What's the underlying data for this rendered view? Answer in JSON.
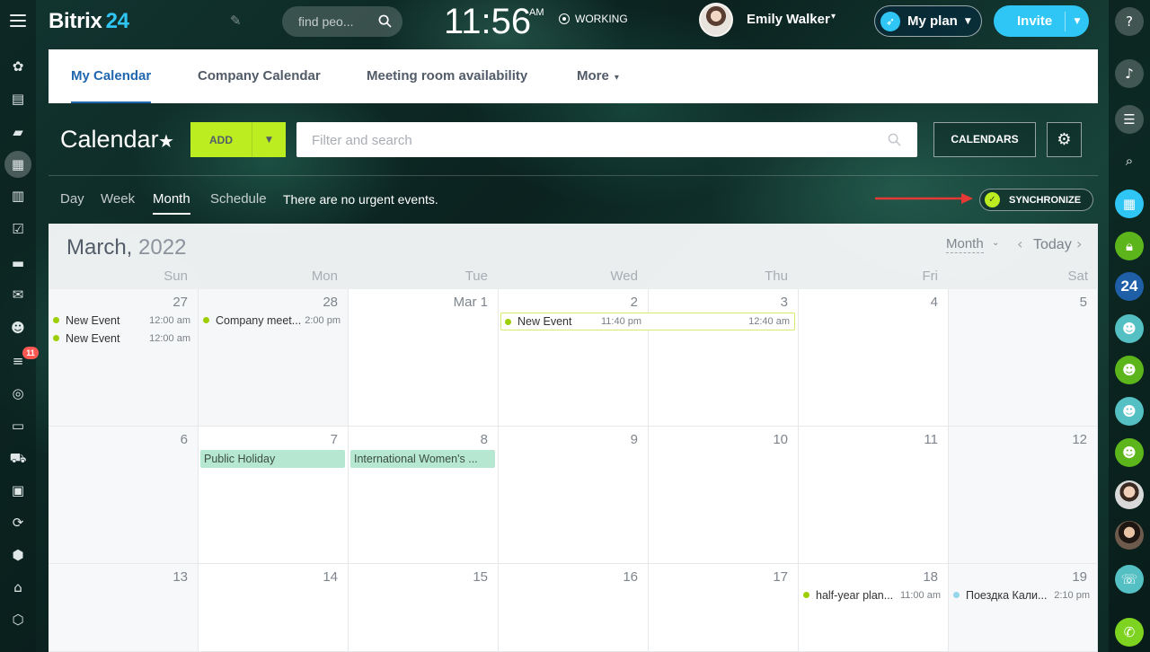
{
  "app": {
    "logo_text": "Bitrix",
    "logo_num": "24"
  },
  "header": {
    "search_placeholder": "find peo...",
    "clock": "11:56",
    "ampm": "AM",
    "work_status": "WORKING",
    "user_name": "Emily Walker",
    "myplan_label": "My plan",
    "invite_label": "Invite"
  },
  "left_sidebar": {
    "icons": [
      "menu-icon",
      "feed-icon",
      "tasks-icon",
      "chat-icon",
      "calendar-icon",
      "docs-icon",
      "checklist-icon",
      "drive-icon",
      "mail-icon",
      "groups-icon",
      "crm-icon",
      "sites-icon",
      "projects-icon",
      "shop-icon",
      "contacts-icon",
      "automation-icon",
      "inventory-icon",
      "marketplace-icon",
      "box-icon"
    ],
    "crm_badge": "11"
  },
  "right_sidebar": {
    "icons": [
      "help-icon",
      "bell-icon",
      "chat-bubble-icon",
      "search-icon",
      "calendar-icon",
      "lock-icon",
      "bitrix24-icon",
      "group-icon",
      "group-icon",
      "group-icon",
      "group-icon",
      "avatar",
      "avatar",
      "phone-icon",
      "call-icon"
    ],
    "bitrix_label": "24"
  },
  "tabs": [
    {
      "label": "My Calendar",
      "active": true
    },
    {
      "label": "Company Calendar",
      "active": false
    },
    {
      "label": "Meeting room availability",
      "active": false
    },
    {
      "label": "More",
      "active": false
    }
  ],
  "toolbar": {
    "title": "Calendar",
    "add_label": "ADD",
    "filter_placeholder": "Filter and search",
    "calendars_label": "CALENDARS"
  },
  "views": {
    "items": [
      "Day",
      "Week",
      "Month",
      "Schedule"
    ],
    "active": "Month",
    "urgent_text": "There are no urgent events.",
    "sync_label": "SYNCHRONIZE"
  },
  "calendar": {
    "month": "March,",
    "year": "2022",
    "view_select": "Month",
    "today_label": "Today",
    "weekdays": [
      "Sun",
      "Mon",
      "Tue",
      "Wed",
      "Thu",
      "Fri",
      "Sat"
    ],
    "weeks": [
      [
        "27",
        "28",
        "Mar 1",
        "2",
        "3",
        "4",
        "5"
      ],
      [
        "6",
        "7",
        "8",
        "9",
        "10",
        "11",
        "12"
      ],
      [
        "13",
        "14",
        "15",
        "16",
        "17",
        "18",
        "19"
      ]
    ],
    "events": {
      "sun27_a": {
        "name": "New Event",
        "time": "12:00 am"
      },
      "sun27_b": {
        "name": "New Event",
        "time": "12:00 am"
      },
      "mon28": {
        "name": "Company meet...",
        "time": "2:00 pm"
      },
      "wed2_multi": {
        "name": "New Event",
        "time_start": "11:40 pm",
        "time_end": "12:40 am"
      },
      "mon7": {
        "name": "Public Holiday"
      },
      "tue8": {
        "name": "International Women's ..."
      },
      "fri18": {
        "name": "half-year plan...",
        "time": "11:00 am"
      },
      "sat19": {
        "name": "Поездка Кали...",
        "time": "2:10 pm"
      }
    }
  },
  "colors": {
    "accent_blue": "#2fc6f6",
    "add_green": "#bbed21",
    "tab_active": "#2067b0",
    "event_dot": "#9dcf00",
    "holiday_bg": "#b5e7d1",
    "arrow_red": "#e53935"
  }
}
